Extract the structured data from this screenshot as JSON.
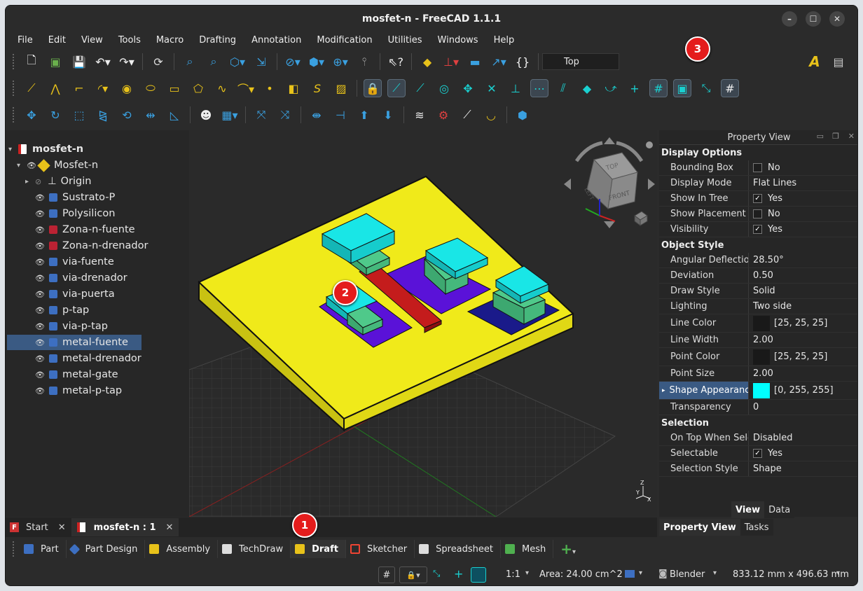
{
  "window": {
    "title": "mosfet-n - FreeCAD 1.1.1"
  },
  "menu": [
    "File",
    "Edit",
    "View",
    "Tools",
    "Macro",
    "Drafting",
    "Annotation",
    "Modification",
    "Utilities",
    "Windows",
    "Help"
  ],
  "toolbar": {
    "view_label": "Top"
  },
  "tree": {
    "root": "mosfet-n",
    "items": [
      "Mosfet-n",
      "Origin",
      "Sustrato-P",
      "Polysilicon",
      "Zona-n-fuente",
      "Zona-n-drenador",
      "via-fuente",
      "via-drenador",
      "via-puerta",
      "p-tap",
      "via-p-tap",
      "metal-fuente",
      "metal-drenador",
      "metal-gate",
      "metal-p-tap"
    ],
    "selected": "metal-fuente"
  },
  "navcube": {
    "top": "TOP",
    "front": "FRONT",
    "left": "LEFT"
  },
  "property_view": {
    "title": "Property View",
    "groups": [
      {
        "name": "Display Options",
        "props": [
          {
            "name": "Bounding Box",
            "value": "No",
            "check": false
          },
          {
            "name": "Display Mode",
            "value": "Flat Lines"
          },
          {
            "name": "Show In Tree",
            "value": "Yes",
            "check": true
          },
          {
            "name": "Show Placement",
            "value": "No",
            "check": false
          },
          {
            "name": "Visibility",
            "value": "Yes",
            "check": true
          }
        ]
      },
      {
        "name": "Object Style",
        "props": [
          {
            "name": "Angular Deflection",
            "value": "28.50°"
          },
          {
            "name": "Deviation",
            "value": "0.50"
          },
          {
            "name": "Draw Style",
            "value": "Solid"
          },
          {
            "name": "Lighting",
            "value": "Two side"
          },
          {
            "name": "Line Color",
            "value": "[25, 25, 25]",
            "color": "#191919"
          },
          {
            "name": "Line Width",
            "value": "2.00"
          },
          {
            "name": "Point Color",
            "value": "[25, 25, 25]",
            "color": "#191919"
          },
          {
            "name": "Point Size",
            "value": "2.00"
          },
          {
            "name": "Shape Appearance",
            "value": "[0, 255, 255]",
            "color": "#00ffff",
            "selected": true
          },
          {
            "name": "Transparency",
            "value": "0"
          }
        ]
      },
      {
        "name": "Selection",
        "props": [
          {
            "name": "On Top When Sele...",
            "value": "Disabled"
          },
          {
            "name": "Selectable",
            "value": "Yes",
            "check": true
          },
          {
            "name": "Selection Style",
            "value": "Shape"
          }
        ]
      }
    ],
    "tabs": [
      "View",
      "Data"
    ],
    "panel_tabs": [
      "Property View",
      "Tasks"
    ]
  },
  "doc_tabs": [
    "Start",
    "mosfet-n : 1"
  ],
  "workbenches": [
    "Part",
    "Part Design",
    "Assembly",
    "TechDraw",
    "Draft",
    "Sketcher",
    "Spreadsheet",
    "Mesh"
  ],
  "active_workbench": "Draft",
  "status": {
    "scale": "1:1",
    "area": "Area: 24.00 cm^2",
    "nav": "Blender",
    "dims": "833.12 mm x 496.63 mm"
  },
  "badges": [
    "1",
    "2",
    "3"
  ],
  "colors": {
    "substrate": "#f0ea1a",
    "metal": "#19e6e6",
    "via": "#4fc98a",
    "diffusion": "#5a12d8",
    "poly": "#c41c1c",
    "ptap": "#1a1a8a"
  }
}
